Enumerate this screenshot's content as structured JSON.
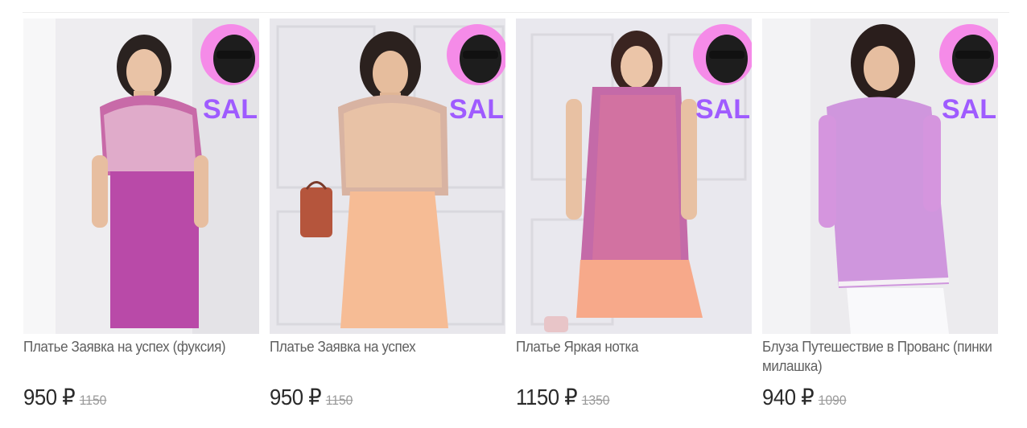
{
  "badge": {
    "text": "SALE",
    "colors": [
      "#ff2fd0",
      "#6a5cff"
    ]
  },
  "colors": {
    "title": "#606060",
    "price": "#2a2a2a",
    "old_price": "#9a9a9a"
  },
  "products": [
    {
      "title": "Платье Заявка на успех (фуксия)",
      "price": "950 ₽",
      "old_price": "1150",
      "image": "dress-fuchsia-photo"
    },
    {
      "title": "Платье Заявка на успех",
      "price": "950 ₽",
      "old_price": "1150",
      "image": "dress-peach-photo"
    },
    {
      "title": "Платье Яркая нотка",
      "price": "1150 ₽",
      "old_price": "1350",
      "image": "dress-pattern-photo"
    },
    {
      "title": "Блуза Путешествие в Прованс (пинки милашка)",
      "price": "940 ₽",
      "old_price": "1090",
      "image": "blouse-lilac-photo"
    }
  ]
}
